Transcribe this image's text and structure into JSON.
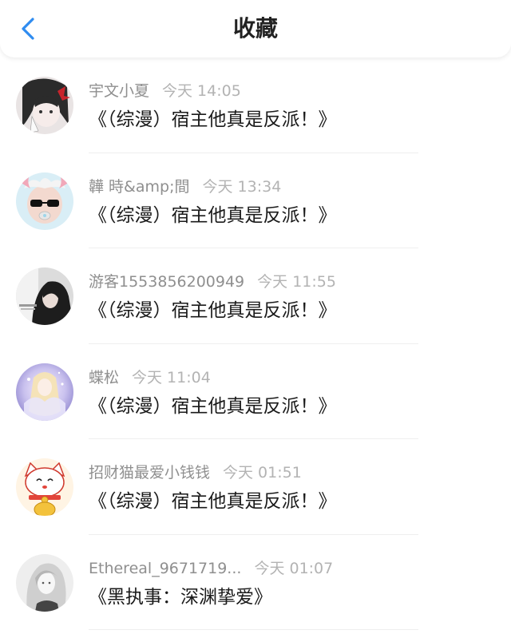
{
  "header": {
    "title": "收藏",
    "back_icon": "chevron-left-icon",
    "accent_color": "#2f8cf0"
  },
  "items": [
    {
      "username": "宇文小夏",
      "time": "今天 14:05",
      "content": "《（综漫）宿主他真是反派！》",
      "avatar_icon": "anime-girl-avatar"
    },
    {
      "username": "韡 時&amp;間",
      "time": "今天 13:34",
      "content": "《（综漫）宿主他真是反派！》",
      "avatar_icon": "sunglasses-person-avatar"
    },
    {
      "username": "游客1553856200949",
      "time": "今天 11:55",
      "content": "《（综漫）宿主他真是反派！》",
      "avatar_icon": "dark-portrait-avatar"
    },
    {
      "username": "蝶松",
      "time": "今天 11:04",
      "content": "《（综漫）宿主他真是反派！》",
      "avatar_icon": "fantasy-art-avatar"
    },
    {
      "username": "招财猫最爱小钱钱",
      "time": "今天 01:51",
      "content": "《（综漫）宿主他真是反派！》",
      "avatar_icon": "lucky-cat-avatar"
    },
    {
      "username": "Ethereal_9671719...",
      "time": "今天 01:07",
      "content": "《黑执事：深渊挚爱》",
      "avatar_icon": "sketch-portrait-avatar"
    }
  ]
}
